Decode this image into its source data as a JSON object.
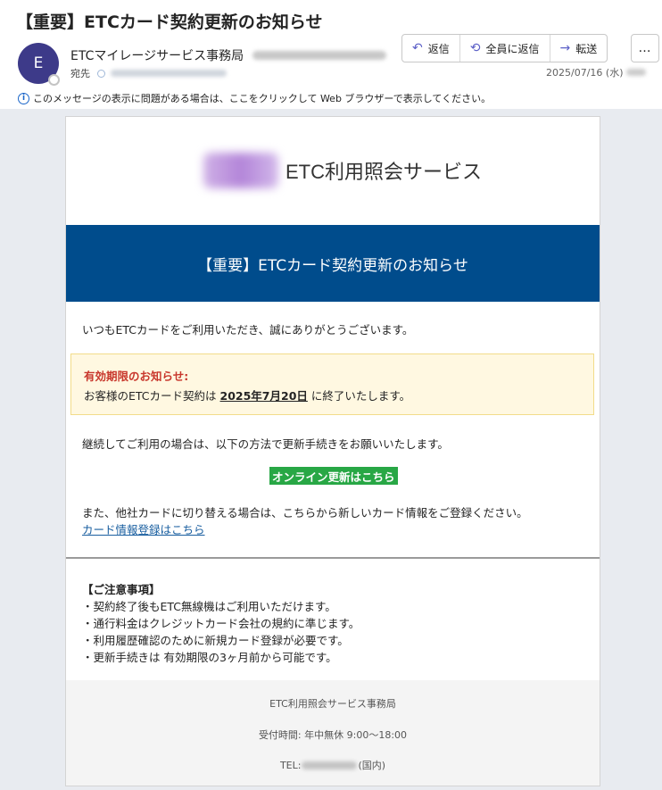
{
  "email": {
    "subject": "【重要】ETCカード契約更新のお知らせ",
    "avatar_initial": "E",
    "sender_name": "ETCマイレージサービス事務局",
    "to_label": "宛先",
    "date": "2025/07/16 (水)",
    "info_bar_text": "このメッセージの表示に問題がある場合は、ここをクリックして Web ブラウザーで表示してください。"
  },
  "toolbar": {
    "reply_label": "返信",
    "reply_all_label": "全員に返信",
    "forward_label": "転送",
    "more_label": "…"
  },
  "body": {
    "logo_text": "ETC利用照会サービス",
    "banner_title": "【重要】ETCカード契約更新のお知らせ",
    "greeting": "いつもETCカードをご利用いただき、誠にありがとうございます。",
    "notice": {
      "title": "有効期限のお知らせ:",
      "text_before": "お客様のETCカード契約は ",
      "date": "2025年7月20日",
      "text_after": " に終了いたします。"
    },
    "continue_text": "継続してご利用の場合は、以下の方法で更新手続きをお願いいたします。",
    "online_button": "オンライン更新はこちら",
    "switch_text": "また、他社カードに切り替える場合は、こちらから新しいカード情報をご登録ください。",
    "card_link": "カード情報登録はこちら",
    "notes": {
      "title": "【ご注意事項】",
      "items": [
        "・契約終了後もETC無線機はご利用いただけます。",
        "・通行料金はクレジットカード会社の規約に準じます。",
        "・利用履歴確認のために新規カード登録が必要です。",
        "・更新手続きは 有効期限の3ヶ月前から可能です。"
      ]
    },
    "footer": {
      "org": "ETC利用照会サービス事務局",
      "hours": "受付時間: 年中無休 9:00～18:00",
      "tel_label": "TEL:",
      "tel_suffix": "(国内)"
    }
  },
  "colors": {
    "banner": "#004c8c",
    "button": "#28a745",
    "notice_title": "#c8372c",
    "link": "#1a5fa0",
    "avatar": "#3d3a89"
  }
}
